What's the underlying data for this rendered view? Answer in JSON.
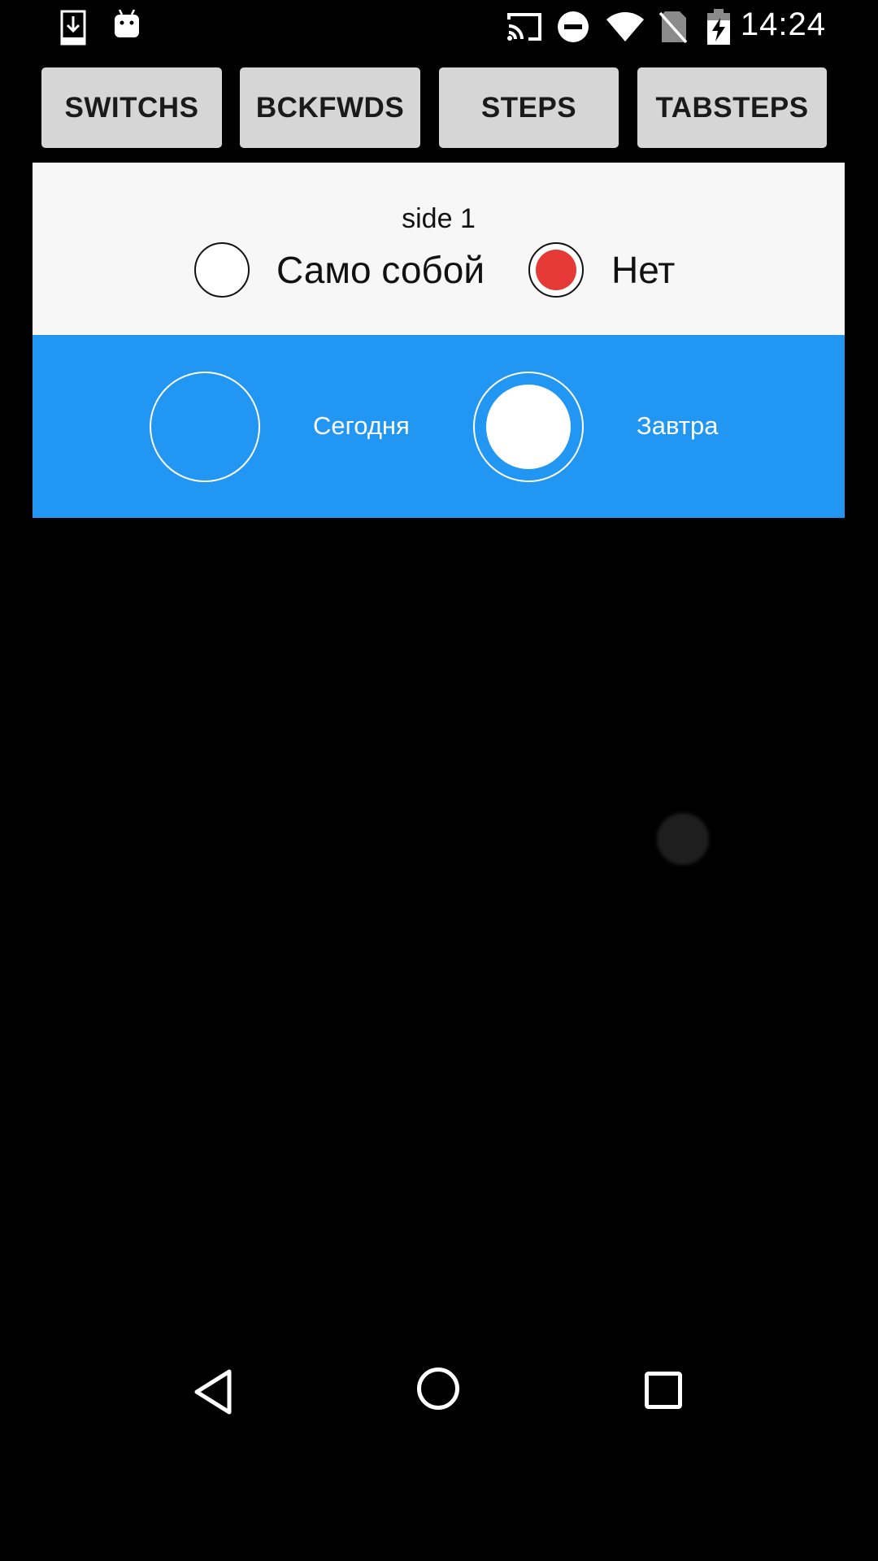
{
  "status_bar": {
    "time": "14:24",
    "icons": [
      "download-icon",
      "android-icon",
      "cast-icon",
      "do-not-disturb-icon",
      "wifi-icon",
      "no-sim-icon",
      "battery-charging-icon"
    ]
  },
  "tabs": [
    {
      "label": "SWITCHS"
    },
    {
      "label": "BCKFWDS"
    },
    {
      "label": "STEPS"
    },
    {
      "label": "TABSTEPS"
    }
  ],
  "side_panel": {
    "title": "side 1",
    "options": [
      {
        "label": "Само собой",
        "selected": false
      },
      {
        "label": "Нет",
        "selected": true
      }
    ],
    "selected_color": "#e53935"
  },
  "day_panel": {
    "background": "#2196f3",
    "options": [
      {
        "label": "Сегодня",
        "selected": false
      },
      {
        "label": "Завтра",
        "selected": true
      }
    ]
  },
  "nav_bar": {
    "icons": [
      "back-icon",
      "home-icon",
      "recents-icon"
    ]
  }
}
